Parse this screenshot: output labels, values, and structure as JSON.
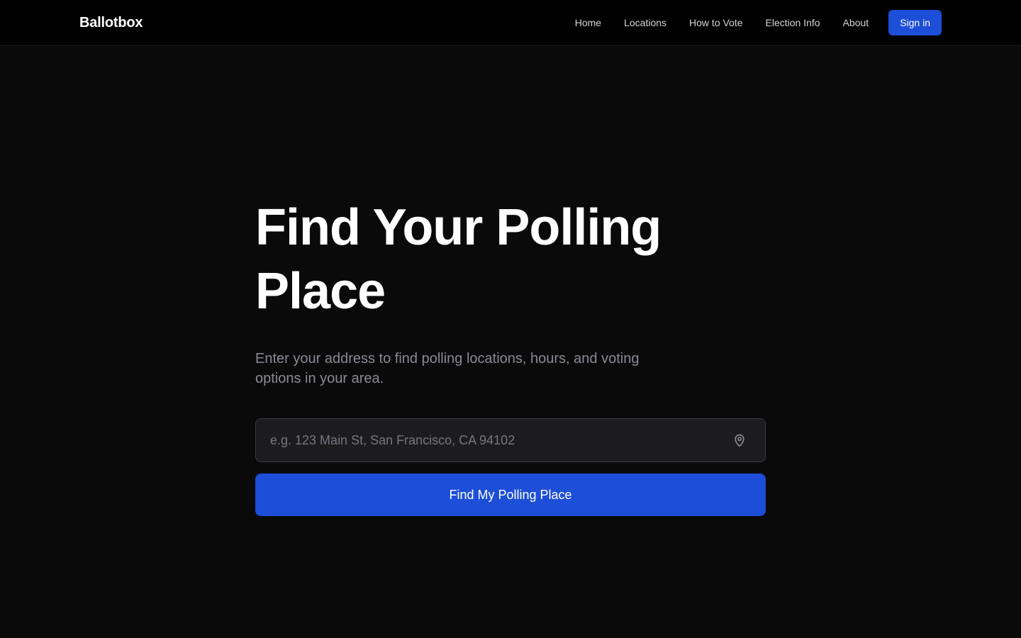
{
  "header": {
    "brand": "Ballotbox",
    "nav": {
      "home": "Home",
      "locations": "Locations",
      "how_to_vote": "How to Vote",
      "election_info": "Election Info",
      "about": "About"
    },
    "sign_in_label": "Sign in"
  },
  "hero": {
    "title": "Find Your Polling Place",
    "subtitle": "Enter your address to find polling locations, hours, and voting options in your area.",
    "search": {
      "value": "",
      "placeholder": "e.g. 123 Main St, San Francisco, CA 94102",
      "icon": "map-pin-icon"
    },
    "submit_label": "Find My Polling Place"
  },
  "colors": {
    "accent": "#1d4ed8",
    "background": "#0a0a0b",
    "header_background": "#000000",
    "muted_text": "#8a8a93"
  }
}
